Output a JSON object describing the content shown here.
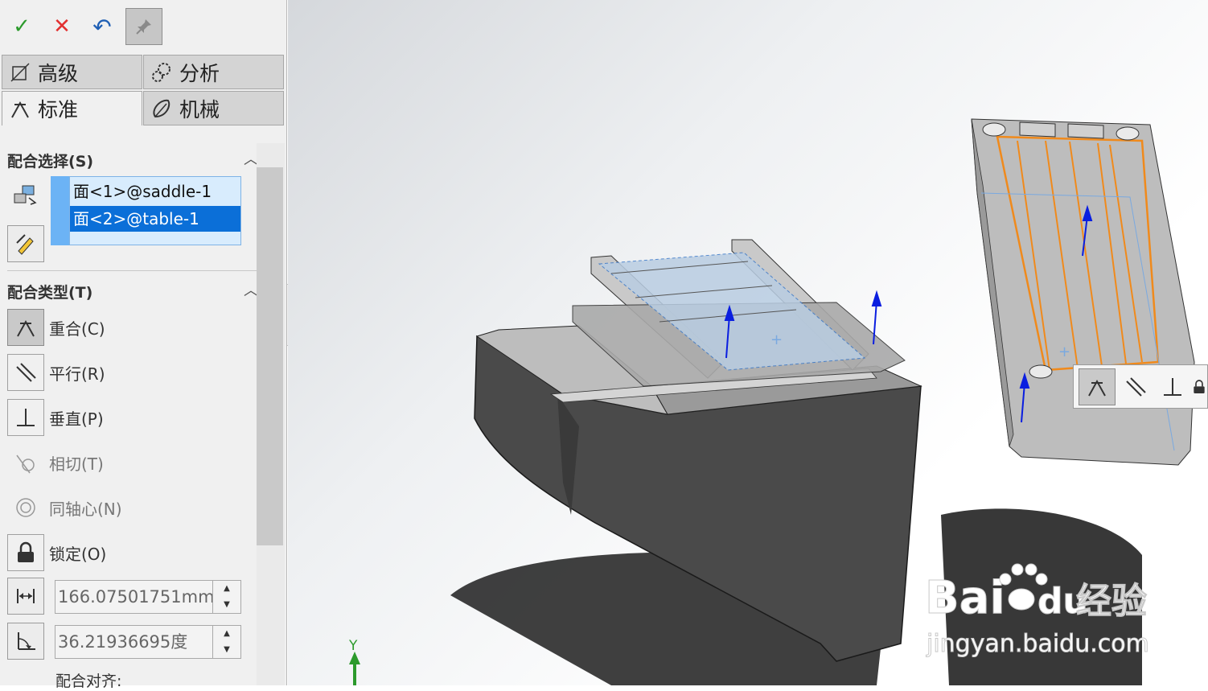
{
  "toolbar": {
    "ok_icon": "check-icon",
    "cancel_icon": "close-icon",
    "undo_icon": "undo-icon",
    "pin_icon": "pushpin-icon",
    "ok_glyph": "✓",
    "cancel_glyph": "✕",
    "undo_glyph": "↶",
    "pin_glyph": "📌"
  },
  "tabs": [
    {
      "label": "高级",
      "icon": "advanced-mate-icon",
      "active": false
    },
    {
      "label": "分析",
      "icon": "analysis-gears-icon",
      "active": false
    },
    {
      "label": "标准",
      "icon": "standard-mate-icon",
      "active": true
    },
    {
      "label": "机械",
      "icon": "mechanical-mate-icon",
      "active": false
    }
  ],
  "mate_selections": {
    "title": "配合选择(S)",
    "items": [
      {
        "text": "面<1>@saddle-1",
        "selected": false
      },
      {
        "text": "面<2>@table-1",
        "selected": true
      }
    ]
  },
  "mate_types": {
    "title": "配合类型(T)",
    "items": [
      {
        "label": "重合(C)",
        "icon": "coincident-icon",
        "active": true,
        "enabled": true
      },
      {
        "label": "平行(R)",
        "icon": "parallel-icon",
        "active": false,
        "enabled": true
      },
      {
        "label": "垂直(P)",
        "icon": "perpendicular-icon",
        "active": false,
        "enabled": true
      },
      {
        "label": "相切(T)",
        "icon": "tangent-icon",
        "active": false,
        "enabled": false
      },
      {
        "label": "同轴心(N)",
        "icon": "concentric-icon",
        "active": false,
        "enabled": false
      },
      {
        "label": "锁定(O)",
        "icon": "lock-icon",
        "active": false,
        "enabled": true
      }
    ],
    "distance_value": "166.07501751mm",
    "angle_value": "36.21936695度"
  },
  "mate_alignment_label": "配合对齐:",
  "viewport": {
    "triad_axis_label": "Y",
    "context_toolbar": [
      "coincident-icon",
      "parallel-icon",
      "perpendicular-icon",
      "lock-icon"
    ]
  },
  "watermark": {
    "brand": "Bai",
    "brand2": "du",
    "cn": "经验",
    "url": "jingyan.baidu.com"
  },
  "colors": {
    "selection_blue": "#0b6fd8",
    "selection_light": "#d8ecfd",
    "ok_green": "#2c9a2c",
    "cancel_red": "#e23030",
    "edge_orange": "#f08a1c",
    "arrow_blue": "#0a1ee0"
  }
}
